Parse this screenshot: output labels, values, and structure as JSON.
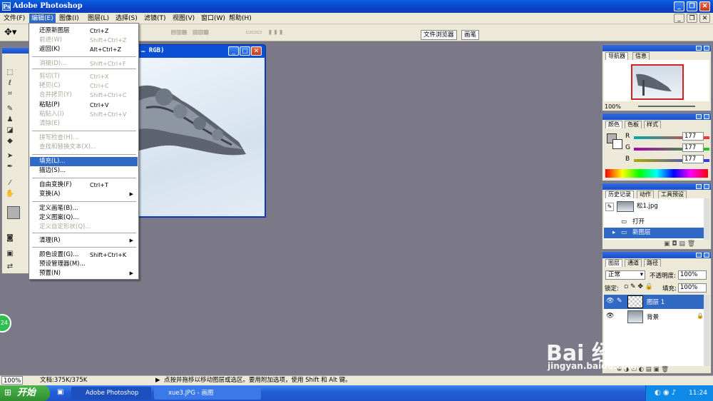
{
  "app": {
    "title": "Adobe Photoshop",
    "logo": "Ps"
  },
  "menubar": [
    "文件(F)",
    "编辑(E)",
    "图像(I)",
    "图层(L)",
    "选择(S)",
    "滤镜(T)",
    "视图(V)",
    "窗口(W)",
    "帮助(H)"
  ],
  "options_bar": {
    "tab1": "文件浏览器",
    "tab2": "画笔"
  },
  "document": {
    "title": "… RGB)"
  },
  "edit_menu": [
    {
      "label": "还原新图层",
      "shortcut": "Ctrl+Z",
      "state": "normal"
    },
    {
      "label": "前进(W)",
      "shortcut": "Shift+Ctrl+Z",
      "state": "disabled"
    },
    {
      "label": "返回(K)",
      "shortcut": "Alt+Ctrl+Z",
      "state": "normal"
    },
    {
      "label": "消褪(D)...",
      "shortcut": "Shift+Ctrl+F",
      "state": "disabled"
    },
    {
      "label": "剪切(T)",
      "shortcut": "Ctrl+X",
      "state": "disabled"
    },
    {
      "label": "拷贝(C)",
      "shortcut": "Ctrl+C",
      "state": "disabled"
    },
    {
      "label": "合并拷贝(Y)",
      "shortcut": "Shift+Ctrl+C",
      "state": "disabled"
    },
    {
      "label": "粘贴(P)",
      "shortcut": "Ctrl+V",
      "state": "normal"
    },
    {
      "label": "粘贴入(I)",
      "shortcut": "Shift+Ctrl+V",
      "state": "disabled"
    },
    {
      "label": "清除(E)",
      "shortcut": "",
      "state": "disabled"
    },
    {
      "label": "拼写检查(H)...",
      "shortcut": "",
      "state": "disabled"
    },
    {
      "label": "查找和替换文本(X)...",
      "shortcut": "",
      "state": "disabled"
    },
    {
      "label": "填充(L)...",
      "shortcut": "",
      "state": "highlight"
    },
    {
      "label": "描边(S)...",
      "shortcut": "",
      "state": "normal"
    },
    {
      "label": "自由变换(F)",
      "shortcut": "Ctrl+T",
      "state": "normal"
    },
    {
      "label": "变换(A)",
      "shortcut": "",
      "state": "submenu"
    },
    {
      "label": "定义画笔(B)...",
      "shortcut": "",
      "state": "normal"
    },
    {
      "label": "定义图案(Q)...",
      "shortcut": "",
      "state": "normal"
    },
    {
      "label": "定义自定形状(Q)...",
      "shortcut": "",
      "state": "disabled"
    },
    {
      "label": "清理(R)",
      "shortcut": "",
      "state": "submenu"
    },
    {
      "label": "颜色设置(G)...",
      "shortcut": "Shift+Ctrl+K",
      "state": "normal"
    },
    {
      "label": "预设管理器(M)...",
      "shortcut": "",
      "state": "normal"
    },
    {
      "label": "预置(N)",
      "shortcut": "",
      "state": "submenu"
    }
  ],
  "navigator": {
    "tabs": [
      "导航器",
      "信息"
    ],
    "zoom": "100%"
  },
  "color_panel": {
    "tabs": [
      "颜色",
      "色板",
      "样式"
    ],
    "r_label": "R",
    "g_label": "G",
    "b_label": "B",
    "r": "177",
    "g": "177",
    "b": "177"
  },
  "history_panel": {
    "tabs": [
      "历史记录",
      "动作",
      "工具预设"
    ],
    "snapshot": "松1.jpg",
    "items": [
      "打开",
      "新图层"
    ]
  },
  "layers_panel": {
    "tabs": [
      "图层",
      "通道",
      "路径"
    ],
    "blend_mode": "正常",
    "opacity_label": "不透明度:",
    "opacity": "100%",
    "lock_label": "锁定:",
    "fill_label": "填充:",
    "fill": "100%",
    "layers": [
      "图层 1",
      "背景"
    ]
  },
  "statusbar": {
    "zoom": "100%",
    "doc": "文档:375K/375K",
    "hint": "点按并拖移以移动图层或选区。要用附加选项，使用 Shift 和 Alt 键。"
  },
  "taskbar": {
    "start": "开始",
    "tasks": [
      "Adobe Photoshop",
      "xue3.JPG - 画图"
    ],
    "clock": "11:24"
  },
  "watermark": {
    "brand": "Bai  经验",
    "url": "jingyan.baidu.com"
  },
  "green_badge": "24"
}
